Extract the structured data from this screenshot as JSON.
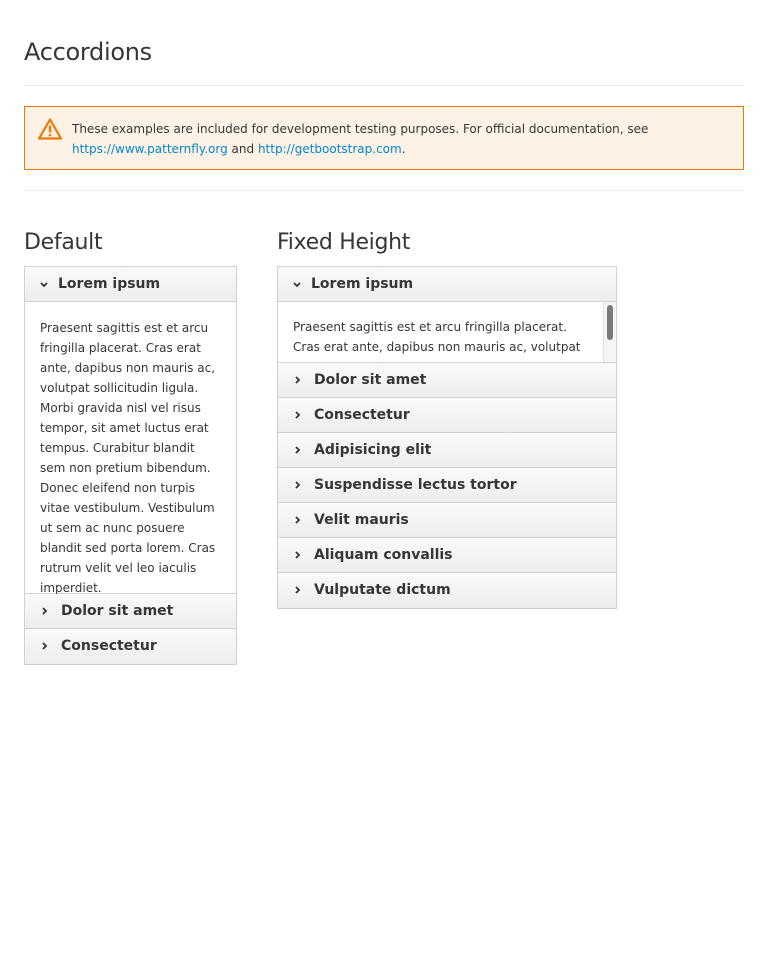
{
  "page": {
    "title": "Accordions"
  },
  "alert": {
    "icon": "warning-triangle-icon",
    "text": "These examples are included for development testing purposes. For official documentation, see ",
    "link1": "https://www.patternfly.org",
    "and": " and ",
    "link2": "http://getbootstrap.com",
    "end": ".",
    "colors": {
      "border": "#ec7a08",
      "background": "#fdf2e5",
      "link": "#0088ce"
    }
  },
  "default": {
    "title": "Default",
    "open_panel": {
      "label": "Lorem ipsum",
      "body": "Praesent sagittis est et arcu fringilla placerat. Cras erat ante, dapibus non mauris ac, volutpat sollicitudin ligula. Morbi gravida nisl vel risus tempor, sit amet luctus erat tempus. Curabitur blandit sem non pretium bibendum. Donec eleifend non turpis vitae vestibulum. Vestibulum ut sem ac nunc posuere blandit sed porta lorem. Cras rutrum velit vel leo iaculis imperdiet."
    },
    "panels": [
      "Dolor sit amet",
      "Consectetur"
    ]
  },
  "fixed": {
    "title": "Fixed Height",
    "open_panel": {
      "label": "Lorem ipsum",
      "body": "Praesent sagittis est et arcu fringilla placerat. Cras erat ante, dapibus non mauris ac, volutpat"
    },
    "panels": [
      "Dolor sit amet",
      "Consectetur",
      "Adipisicing elit",
      "Suspendisse lectus tortor",
      "Velit mauris",
      "Aliquam convallis",
      "Vulputate dictum"
    ]
  }
}
